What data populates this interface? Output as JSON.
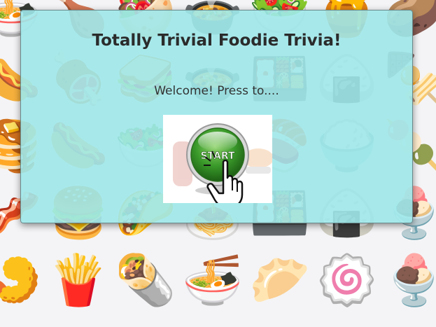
{
  "background": {
    "foods": [
      "🍜",
      "🍗",
      "🥙",
      "🍲",
      "🥗",
      "🍯",
      "🥔",
      "🌭",
      "🍖",
      "🥪",
      "🍲",
      "🍱",
      "🍙",
      "🍢",
      "🥞",
      "🌭",
      "🥗",
      "🌯",
      "🍣",
      "🍚",
      "🍡",
      "🥓",
      "🍔",
      "🌮",
      "🍝",
      "🍱",
      "🍙",
      "🍨",
      "🍤",
      "🍟",
      "🌯",
      "🍜",
      "🥟",
      "🍥",
      "🍨"
    ]
  },
  "dialog": {
    "title": "Totally Trivial Foodie Trivia!",
    "subtitle": "Welcome! Press to....",
    "start_label": "START"
  },
  "colors": {
    "dialog_bg": "#9ee8ea",
    "start_green": "#3a9a2a"
  }
}
